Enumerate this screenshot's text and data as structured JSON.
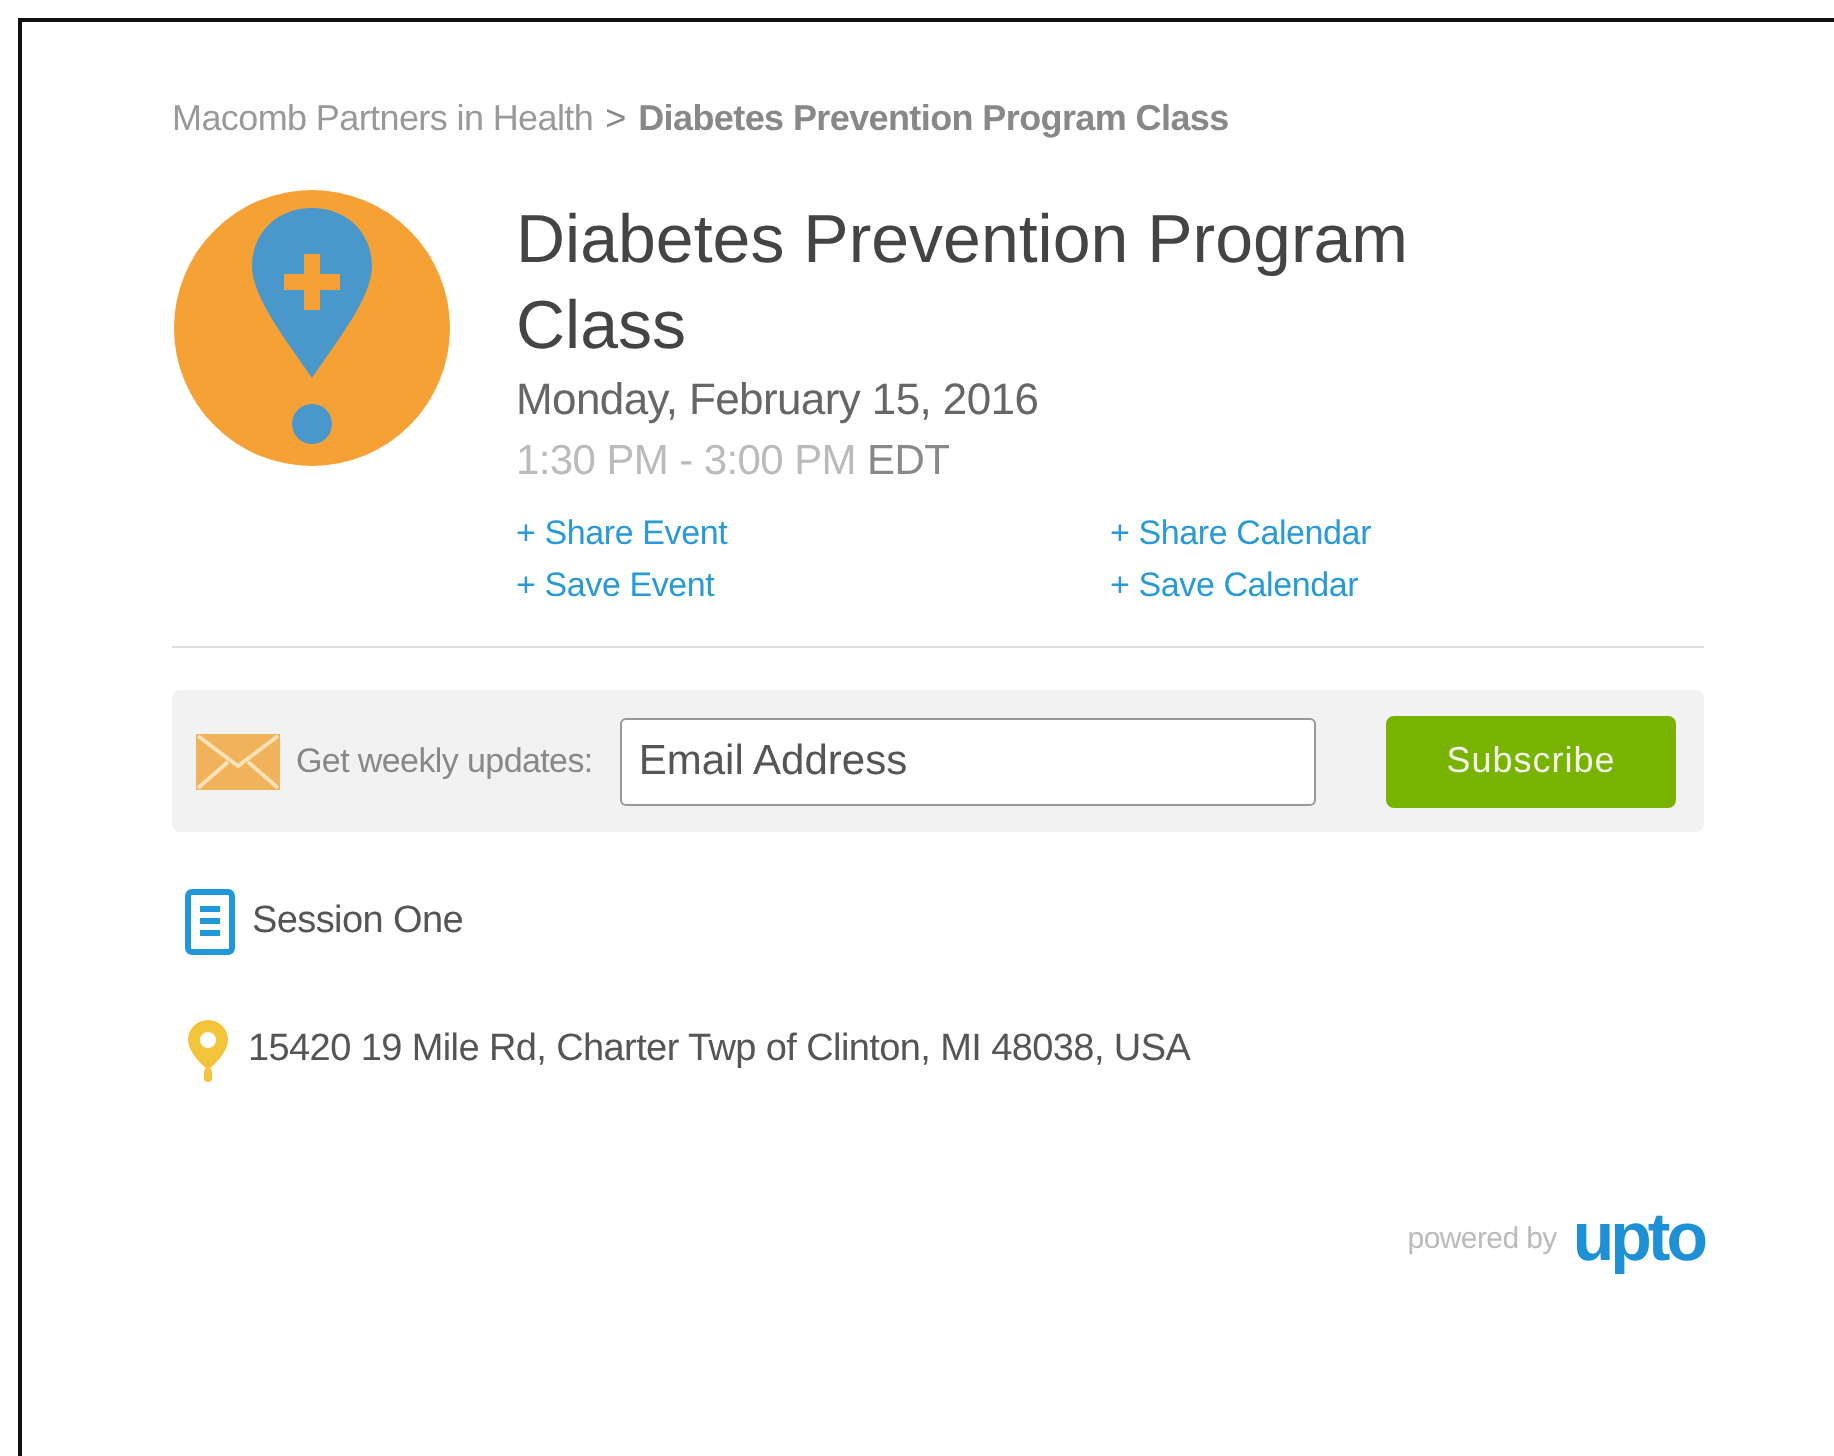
{
  "breadcrumb": {
    "parent": "Macomb Partners in Health",
    "separator": ">",
    "current": "Diabetes Prevention Program Class"
  },
  "event": {
    "title": "Diabetes Prevention Program Class",
    "date": "Monday, February 15, 2016",
    "time": "1:30 PM - 3:00 PM **EDT**",
    "links": [
      {
        "label": "+ Share Event"
      },
      {
        "label": "+ Share Calendar"
      },
      {
        "label": "+ Save Event"
      },
      {
        "label": "+ Save Calendar"
      }
    ]
  },
  "subscribe": {
    "label": "Get weekly updates:",
    "placeholder": "Email Address",
    "button": "Subscribe"
  },
  "details": [
    {
      "kind": "session",
      "text": "Session One"
    },
    {
      "kind": "location",
      "text": "15420 19 Mile Rd, Charter Twp of Clinton, MI 48038, USA"
    }
  ],
  "footer": {
    "powered_by": "powered by",
    "logo": "upto"
  }
}
